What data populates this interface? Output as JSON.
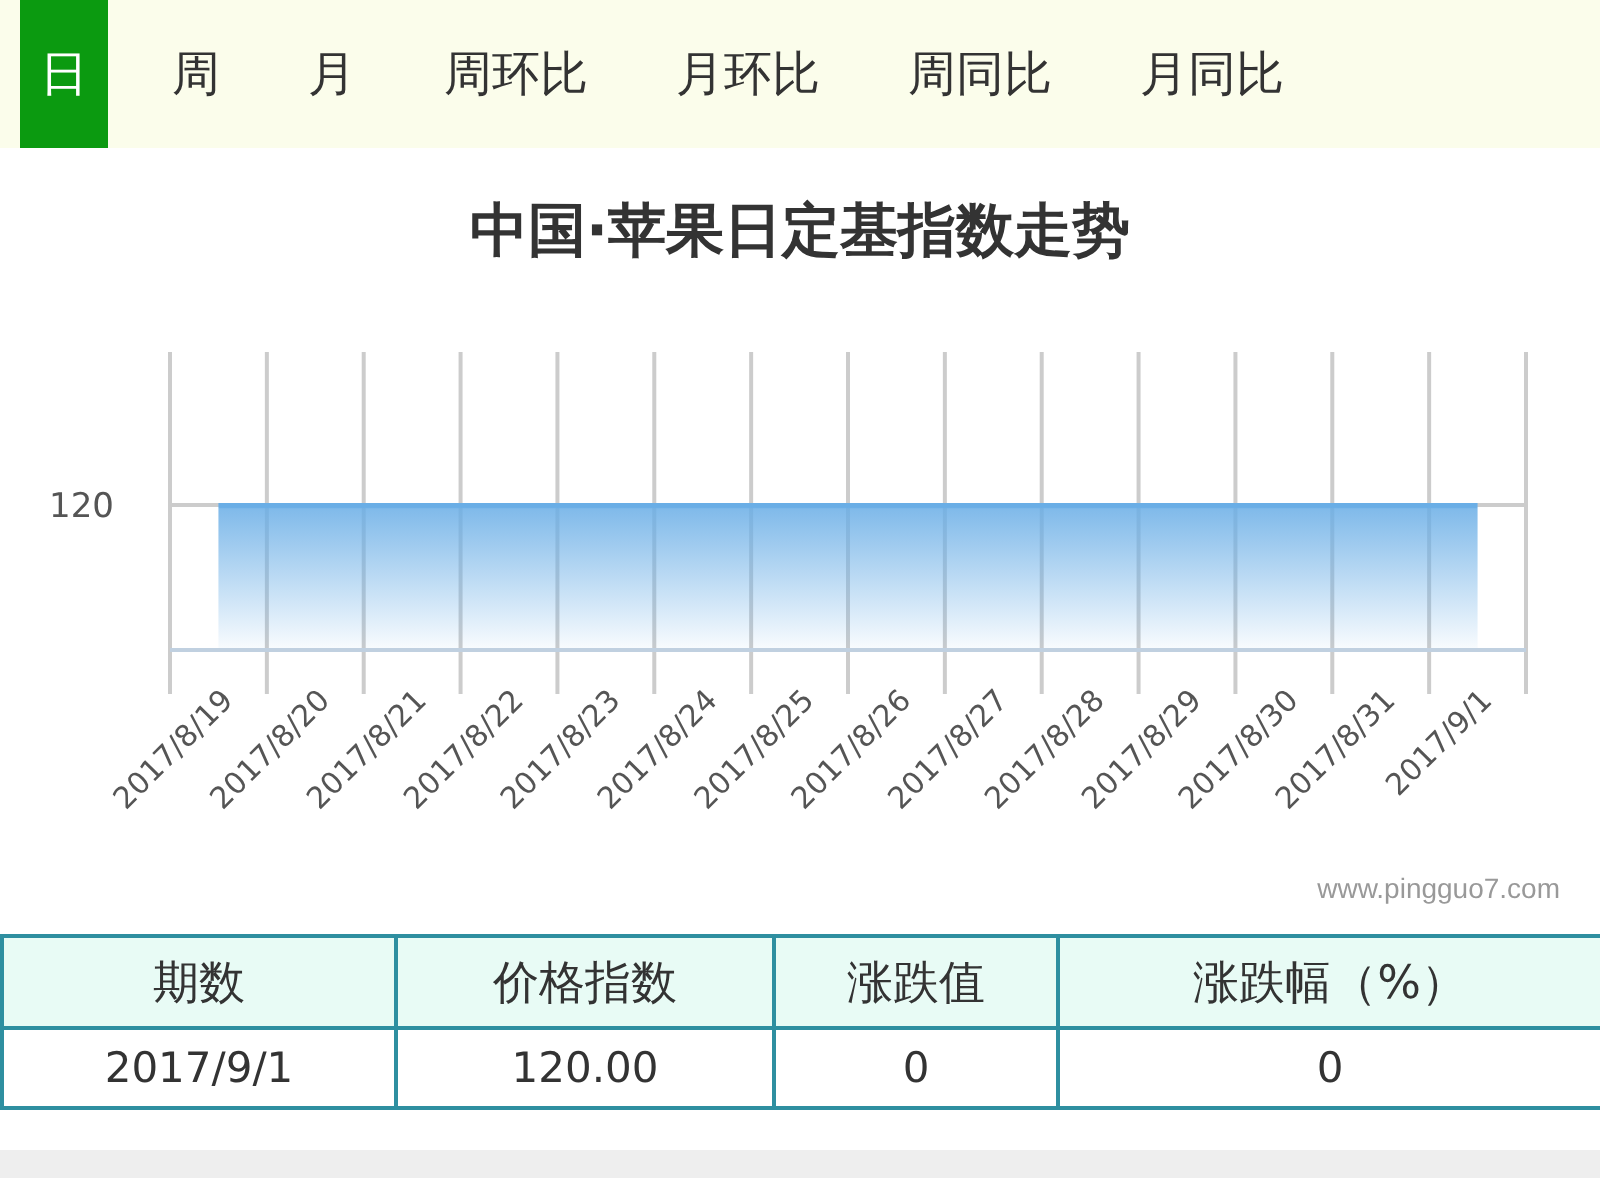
{
  "tabs": [
    {
      "label": "日",
      "selected": true
    },
    {
      "label": "周",
      "selected": false
    },
    {
      "label": "月",
      "selected": false
    },
    {
      "label": "周环比",
      "selected": false
    },
    {
      "label": "月环比",
      "selected": false
    },
    {
      "label": "周同比",
      "selected": false
    },
    {
      "label": "月同比",
      "selected": false
    }
  ],
  "chart": {
    "title": "中国·苹果日定基指数走势",
    "y_label": "120",
    "x_labels": [
      "2017/8/19",
      "2017/8/20",
      "2017/8/21",
      "2017/8/22",
      "2017/8/23",
      "2017/8/24",
      "2017/8/25",
      "2017/8/26",
      "2017/8/27",
      "2017/8/28",
      "2017/8/29",
      "2017/8/30",
      "2017/8/31",
      "2017/9/1"
    ],
    "credit": "www.pingguo7.com"
  },
  "table": {
    "columns": [
      "期数",
      "价格指数",
      "涨跌值",
      "涨跌幅（%）"
    ],
    "rows": [
      [
        "2017/9/1",
        "120.00",
        "0",
        "0"
      ]
    ]
  }
}
